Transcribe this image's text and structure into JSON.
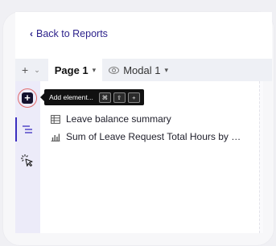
{
  "header": {
    "back_link": "Back to Reports"
  },
  "tabs": {
    "add_symbol": "+",
    "pages": [
      {
        "label": "Page 1",
        "active": true
      },
      {
        "label": "Modal 1",
        "active": false
      }
    ]
  },
  "rail": {
    "add_button_symbol": "+",
    "tooltip": {
      "label": "Add element...",
      "keys": [
        "⌘",
        "⇧",
        "+"
      ]
    }
  },
  "outline": {
    "items": [
      {
        "label": "Leave balance summary",
        "icon": "table-icon"
      },
      {
        "label": "Sum of Leave Request Total Hours by Em...",
        "icon": "bar-chart-icon"
      }
    ]
  },
  "colors": {
    "accent": "#3c2fc0",
    "link": "#2a1f8a",
    "highlight_ring": "#e26a6a",
    "tooltip_bg": "#111111"
  }
}
